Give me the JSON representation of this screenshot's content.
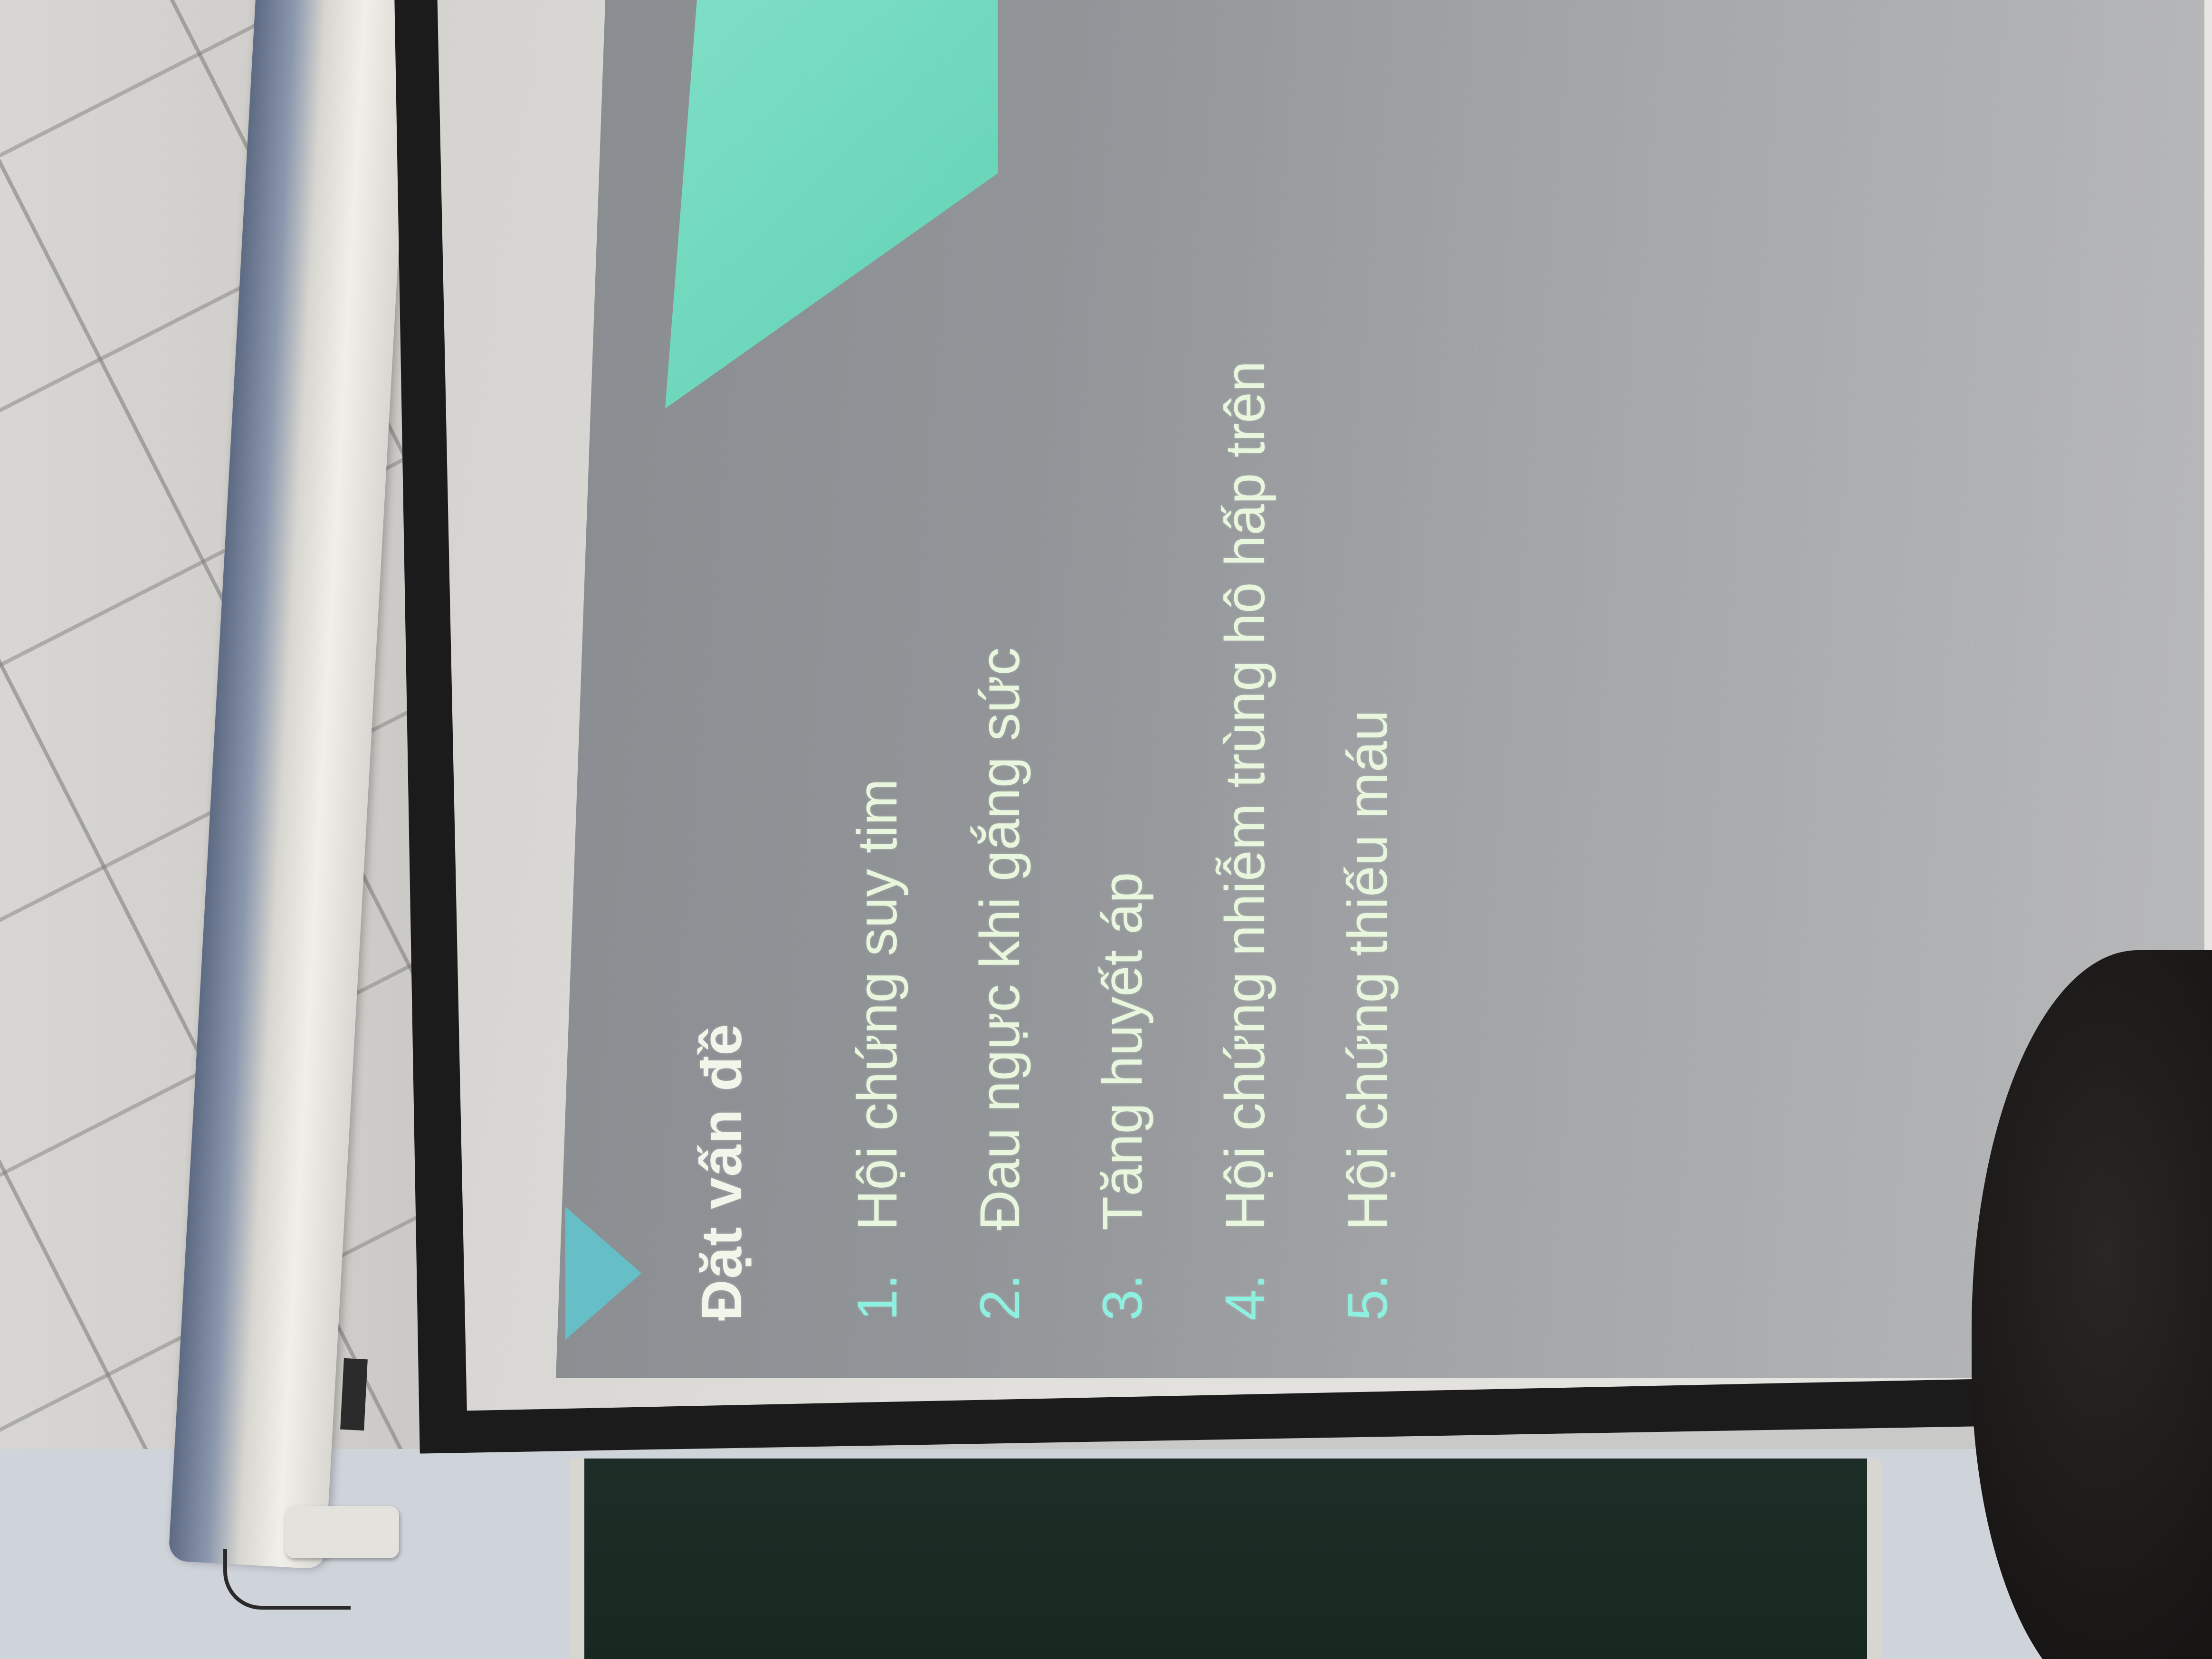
{
  "slide": {
    "title": "Đặt vấn đề",
    "items": [
      {
        "number": "1.",
        "text": "Hội chứng suy tim"
      },
      {
        "number": "2.",
        "text": "Đau ngực khi gắng sức"
      },
      {
        "number": "3.",
        "text": "Tăng huyết áp"
      },
      {
        "number": "4.",
        "text": "Hội chứng nhiễm trùng hô hấp trên"
      },
      {
        "number": "5.",
        "text": "Hội chứng thiếu máu"
      }
    ]
  },
  "colors": {
    "accent": "#7ee8cc",
    "title_text": "#f2f6ea",
    "list_text": "#e8f6de",
    "slide_background": "#8e9195"
  }
}
